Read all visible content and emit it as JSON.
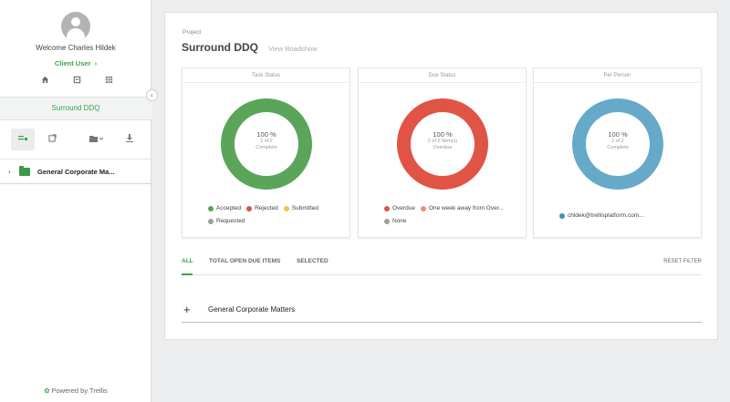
{
  "sidebar": {
    "welcome": "Welcome Charles Hildek",
    "role": "Client User",
    "role_chevron": "›",
    "nav_icons": [
      "home-icon",
      "document-icon",
      "apps-grid-icon"
    ],
    "collapse": "‹",
    "project_name": "Surround DDQ",
    "toolbar_icons": [
      "tree-view-icon",
      "open-external-icon",
      "folder-icon",
      "download-icon"
    ],
    "tree": [
      {
        "label": "General Corporate Ma...",
        "expanded": false
      }
    ],
    "powered_by": "Powered by Trellis"
  },
  "main": {
    "project_label": "Project",
    "title": "Surround DDQ",
    "view_link": "View Roadshow",
    "charts": [
      {
        "title": "Task Status",
        "percent": "100 %",
        "line1": "2 of 2",
        "line2": "Complete",
        "ring_color": "#5aa55a",
        "legend": [
          {
            "label": "Accepted",
            "color": "#5aa55a"
          },
          {
            "label": "Rejected",
            "color": "#e05446"
          },
          {
            "label": "Submitted",
            "color": "#f2c14a"
          },
          {
            "label": "Requested",
            "color": "#9e9e9e"
          }
        ]
      },
      {
        "title": "Due Status",
        "percent": "100 %",
        "line1": "2 of 2 Item(s)",
        "line2": "Overdue",
        "ring_color": "#e05446",
        "legend": [
          {
            "label": "Overdue",
            "color": "#e05446"
          },
          {
            "label": "One week away from Over...",
            "color": "#f08a7e"
          },
          {
            "label": "None",
            "color": "#9e9e9e"
          }
        ]
      },
      {
        "title": "Per Person",
        "percent": "100 %",
        "line1": "2 of 2",
        "line2": "Complete",
        "ring_color": "#67a9c8",
        "legend": [
          {
            "label": "chldek@trellisplatform.com...",
            "color": "#3f8fb8"
          }
        ]
      }
    ],
    "tabs": [
      "ALL",
      "TOTAL OPEN DUE ITEMS",
      "SELECTED"
    ],
    "active_tab": "ALL",
    "reset_filter": "RESET FILTER",
    "groups": [
      {
        "icon": "+",
        "label": "General Corporate Matters"
      }
    ]
  }
}
